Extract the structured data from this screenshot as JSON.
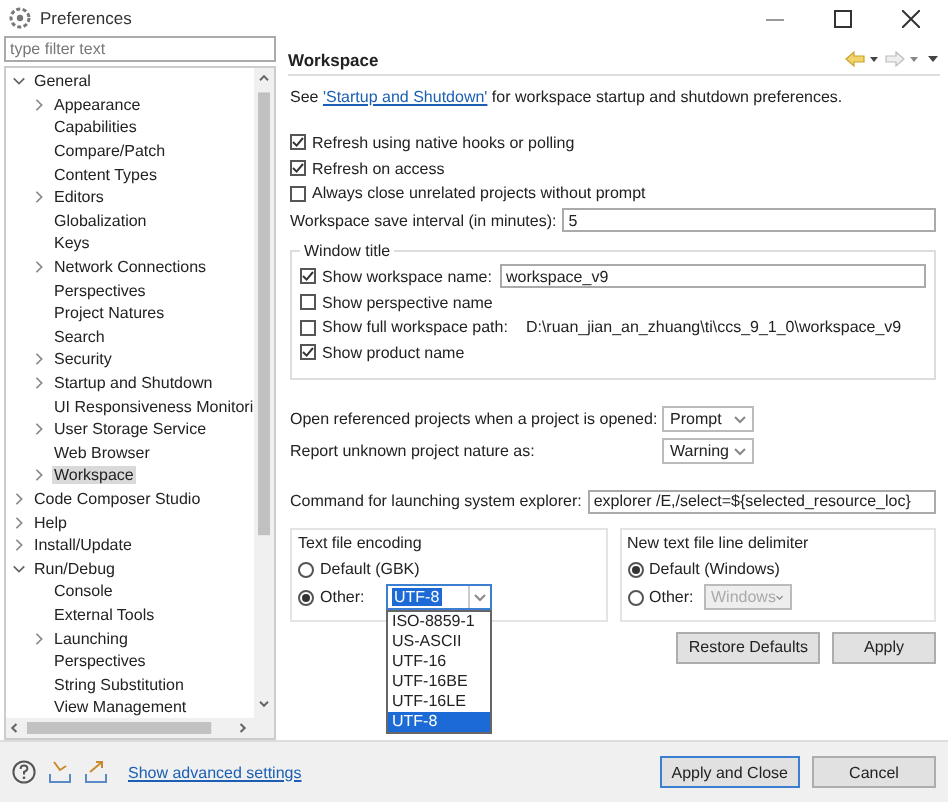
{
  "window": {
    "title": "Preferences"
  },
  "filter": {
    "placeholder": "type filter text"
  },
  "tree": [
    {
      "label": "General",
      "kind": "folder",
      "expanded": true,
      "selected": false,
      "children": [
        {
          "label": "Appearance",
          "kind": "folder",
          "expanded": false,
          "selected": false
        },
        {
          "label": "Capabilities",
          "kind": "leaf",
          "selected": false
        },
        {
          "label": "Compare/Patch",
          "kind": "leaf",
          "selected": false
        },
        {
          "label": "Content Types",
          "kind": "leaf",
          "selected": false
        },
        {
          "label": "Editors",
          "kind": "folder",
          "expanded": false,
          "selected": false
        },
        {
          "label": "Globalization",
          "kind": "leaf",
          "selected": false
        },
        {
          "label": "Keys",
          "kind": "leaf",
          "selected": false
        },
        {
          "label": "Network Connections",
          "kind": "folder",
          "expanded": false,
          "selected": false
        },
        {
          "label": "Perspectives",
          "kind": "leaf",
          "selected": false
        },
        {
          "label": "Project Natures",
          "kind": "leaf",
          "selected": false
        },
        {
          "label": "Search",
          "kind": "leaf",
          "selected": false
        },
        {
          "label": "Security",
          "kind": "folder",
          "expanded": false,
          "selected": false
        },
        {
          "label": "Startup and Shutdown",
          "kind": "folder",
          "expanded": false,
          "selected": false
        },
        {
          "label": "UI Responsiveness Monitori",
          "kind": "leaf",
          "selected": false
        },
        {
          "label": "User Storage Service",
          "kind": "folder",
          "expanded": false,
          "selected": false
        },
        {
          "label": "Web Browser",
          "kind": "leaf",
          "selected": false
        },
        {
          "label": "Workspace",
          "kind": "folder",
          "expanded": false,
          "selected": true
        }
      ]
    },
    {
      "label": "Code Composer Studio",
      "kind": "folder",
      "expanded": false,
      "selected": false
    },
    {
      "label": "Help",
      "kind": "folder",
      "expanded": false,
      "selected": false
    },
    {
      "label": "Install/Update",
      "kind": "folder",
      "expanded": false,
      "selected": false
    },
    {
      "label": "Run/Debug",
      "kind": "folder",
      "expanded": true,
      "selected": false,
      "children": [
        {
          "label": "Console",
          "kind": "leaf",
          "selected": false
        },
        {
          "label": "External Tools",
          "kind": "leaf",
          "selected": false
        },
        {
          "label": "Launching",
          "kind": "folder",
          "expanded": false,
          "selected": false
        },
        {
          "label": "Perspectives",
          "kind": "leaf",
          "selected": false
        },
        {
          "label": "String Substitution",
          "kind": "leaf",
          "selected": false
        },
        {
          "label": "View Management",
          "kind": "leaf",
          "selected": false
        }
      ]
    }
  ],
  "page": {
    "title": "Workspace",
    "intro": {
      "before": "See ",
      "link": "'Startup and Shutdown'",
      "after": " for workspace startup and shutdown preferences."
    },
    "options": [
      {
        "label": "Refresh using native hooks or polling",
        "checked": true
      },
      {
        "label": "Refresh on access",
        "checked": true
      },
      {
        "label": "Always close unrelated projects without prompt",
        "checked": false
      }
    ],
    "save_interval": {
      "label": "Workspace save interval (in minutes):",
      "value": "5"
    },
    "window_title": {
      "title": "Window title",
      "rows": [
        {
          "kind": "field",
          "label": "Show workspace name:",
          "checked": true,
          "value": "workspace_v9"
        },
        {
          "kind": "plain",
          "label": "Show perspective name",
          "checked": false
        },
        {
          "kind": "path",
          "label": "Show full workspace path:",
          "checked": false,
          "value": "D:\\ruan_jian_an_zhuang\\ti\\ccs_9_1_0\\workspace_v9"
        },
        {
          "kind": "plain",
          "label": "Show product name",
          "checked": true
        }
      ]
    },
    "selects": [
      {
        "label": "Open referenced projects when a project is opened:",
        "value": "Prompt"
      },
      {
        "label": "Report unknown project nature as:",
        "value": "Warning"
      }
    ],
    "command": {
      "label": "Command for launching system explorer:",
      "value": "explorer /E,/select=${selected_resource_loc}"
    },
    "encoding": {
      "title": "Text file encoding",
      "options": [
        {
          "label": "Default (GBK)",
          "selected": false
        },
        {
          "label": "Other:",
          "selected": true,
          "value": "UTF-8"
        }
      ],
      "list": [
        {
          "label": "ISO-8859-1",
          "selected": false
        },
        {
          "label": "US-ASCII",
          "selected": false
        },
        {
          "label": "UTF-16",
          "selected": false
        },
        {
          "label": "UTF-16BE",
          "selected": false
        },
        {
          "label": "UTF-16LE",
          "selected": false
        },
        {
          "label": "UTF-8",
          "selected": true
        }
      ]
    },
    "delimiter": {
      "title": "New text file line delimiter",
      "options": [
        {
          "label": "Default (Windows)",
          "selected": true
        },
        {
          "label": "Other:",
          "selected": false,
          "value": "Windows"
        }
      ]
    },
    "buttons": [
      "Restore Defaults",
      "Apply"
    ]
  },
  "footer": {
    "link": "Show advanced settings",
    "buttons": [
      "Apply and Close",
      "Cancel"
    ]
  }
}
